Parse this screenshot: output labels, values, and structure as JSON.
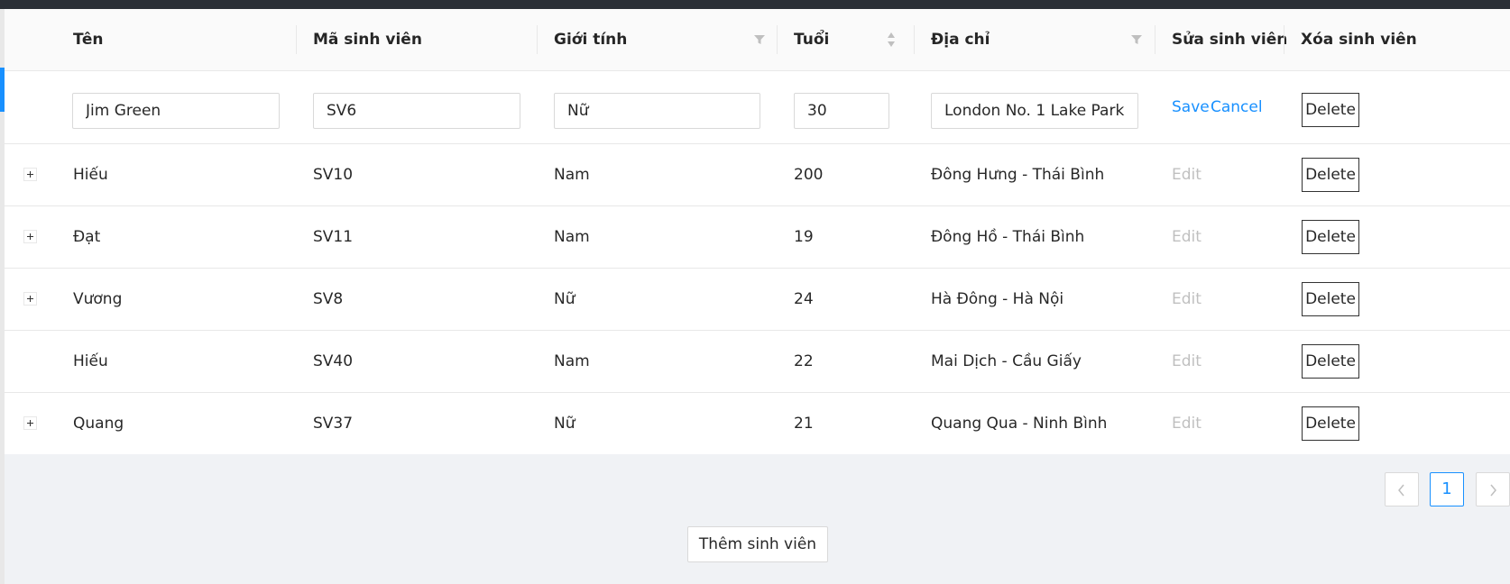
{
  "table": {
    "headers": {
      "name": "Tên",
      "student_id": "Mã sinh viên",
      "gender": "Giới tính",
      "age": "Tuổi",
      "address": "Địa chỉ",
      "edit": "Sửa sinh viên",
      "delete": "Xóa sinh viên"
    },
    "edit_row": {
      "name": "Jim Green",
      "student_id": "SV6",
      "gender": "Nữ",
      "age": "30",
      "address": "London No. 1 Lake Park",
      "save_label": "Save",
      "cancel_label": "Cancel",
      "delete_label": "Delete"
    },
    "rows": [
      {
        "name": "Hiếu",
        "student_id": "SV10",
        "gender": "Nam",
        "age": "200",
        "address": "Đông Hưng - Thái Bình",
        "edit_label": "Edit",
        "delete_label": "Delete",
        "expandable": true
      },
      {
        "name": "Đạt",
        "student_id": "SV11",
        "gender": "Nam",
        "age": "19",
        "address": "Đông Hồ - Thái Bình",
        "edit_label": "Edit",
        "delete_label": "Delete",
        "expandable": true
      },
      {
        "name": "Vương",
        "student_id": "SV8",
        "gender": "Nữ",
        "age": "24",
        "address": "Hà Đông - Hà Nội",
        "edit_label": "Edit",
        "delete_label": "Delete",
        "expandable": true
      },
      {
        "name": "Hiếu",
        "student_id": "SV40",
        "gender": "Nam",
        "age": "22",
        "address": "Mai Dịch - Cầu Giấy",
        "edit_label": "Edit",
        "delete_label": "Delete",
        "expandable": false
      },
      {
        "name": "Quang",
        "student_id": "SV37",
        "gender": "Nữ",
        "age": "21",
        "address": "Quang Qua - Ninh Bình",
        "edit_label": "Edit",
        "delete_label": "Delete",
        "expandable": true
      }
    ]
  },
  "pagination": {
    "prev_icon": "chevron-left-icon",
    "current_page": "1",
    "next_icon": "chevron-right-icon"
  },
  "add_button_label": "Thêm sinh viên",
  "colors": {
    "accent": "#1890ff",
    "header_bg": "#fafafa",
    "page_bg": "#f0f2f5",
    "disabled_text": "rgba(0,0,0,0.25)"
  }
}
